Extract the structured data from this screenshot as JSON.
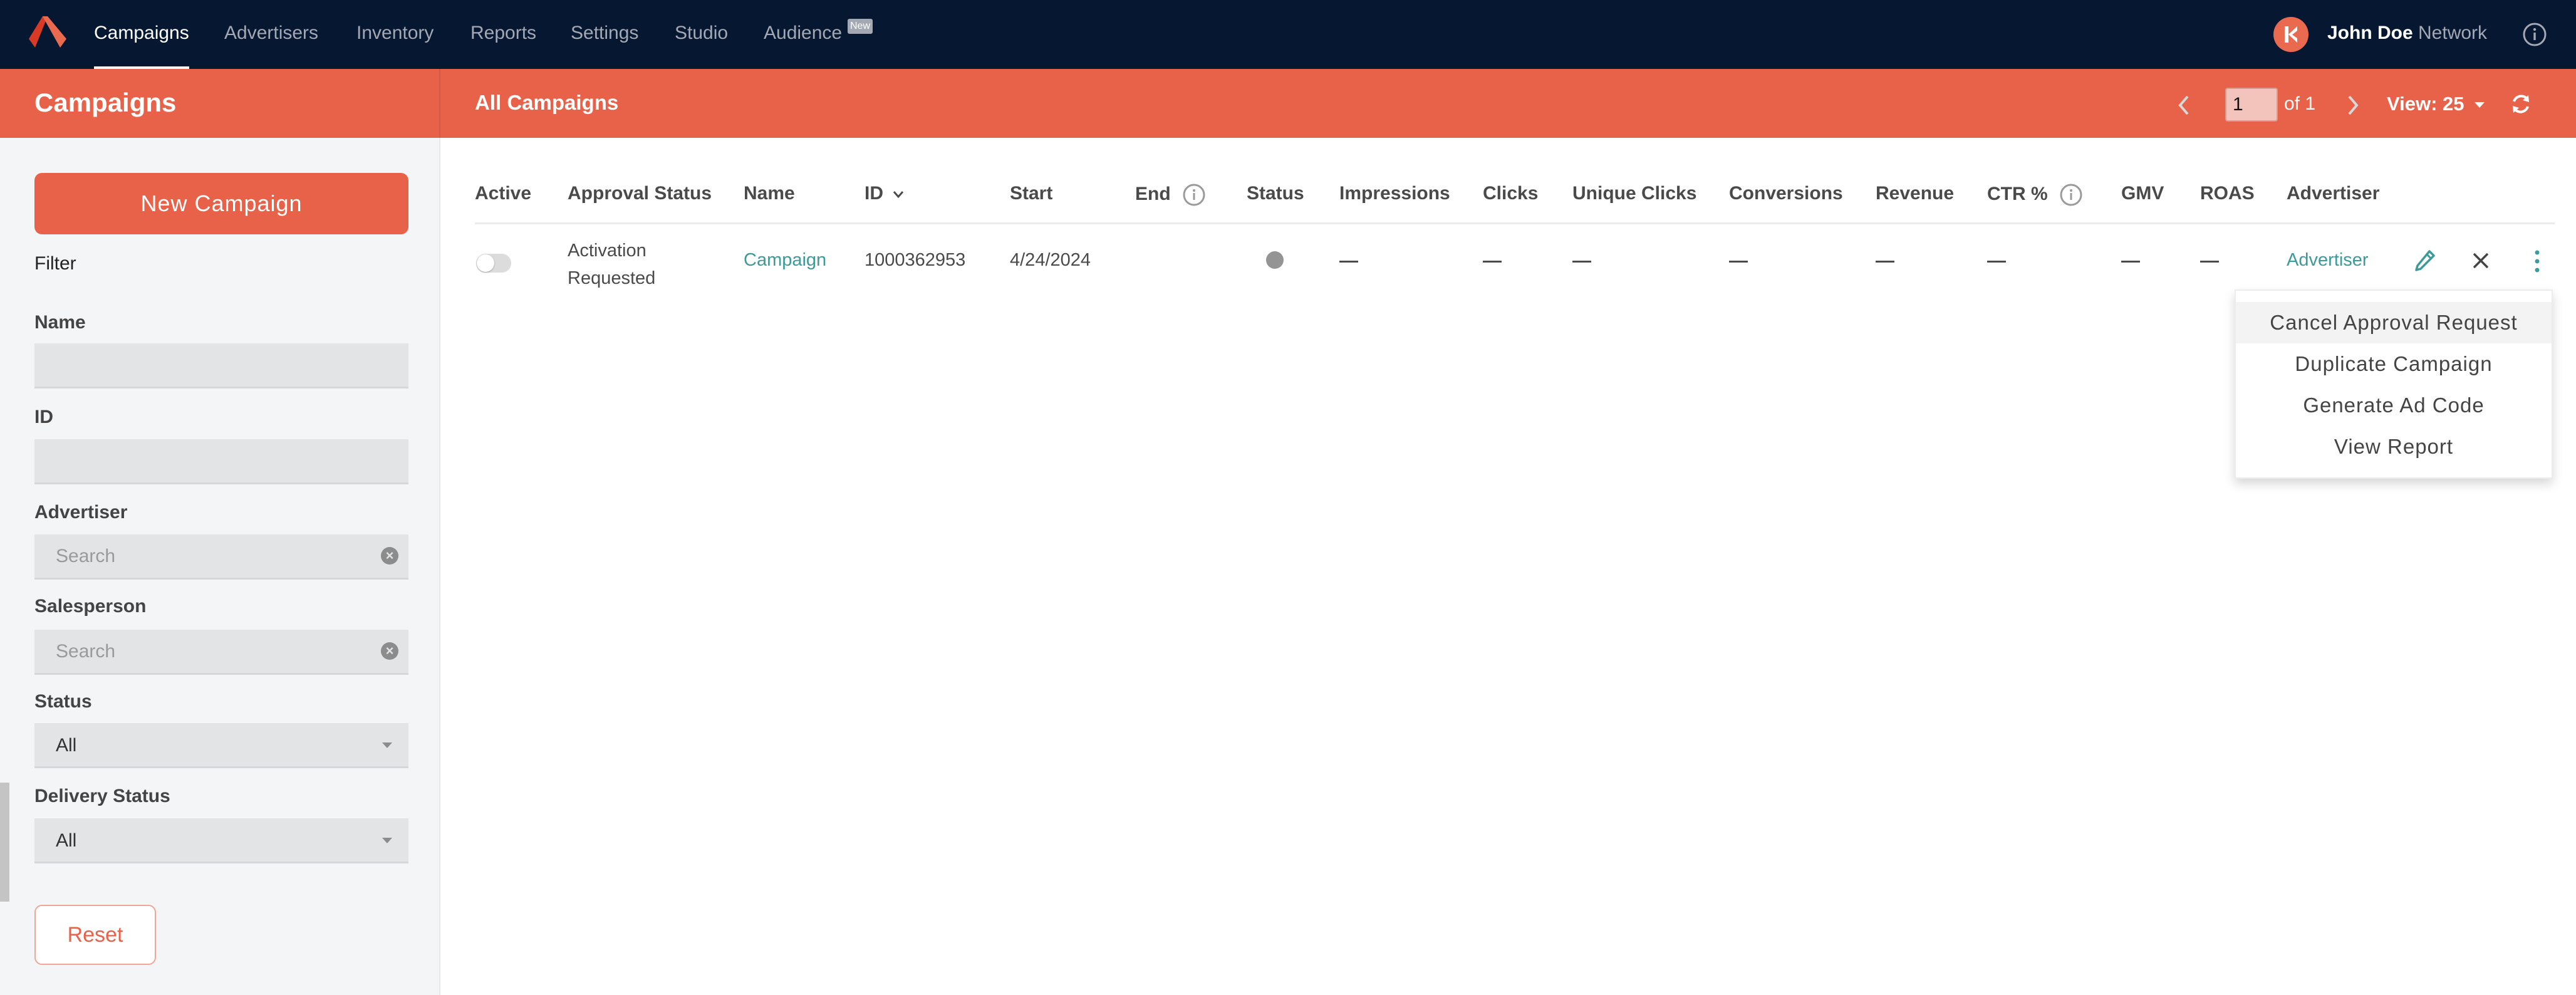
{
  "topnav": {
    "items": [
      {
        "label": "Campaigns",
        "active": true
      },
      {
        "label": "Advertisers",
        "active": false
      },
      {
        "label": "Inventory",
        "active": false
      },
      {
        "label": "Reports",
        "active": false
      },
      {
        "label": "Settings",
        "active": false
      },
      {
        "label": "Studio",
        "active": false
      },
      {
        "label": "Audience",
        "active": false,
        "badge": "New"
      }
    ],
    "user": {
      "name": "John Doe",
      "network": "Network",
      "avatar_letter_icon": "k-logo-icon"
    },
    "info_icon": "info-circle-icon",
    "logo_icon": "chevron-a-logo-icon"
  },
  "subbar": {
    "section_title": "Campaigns",
    "page_title": "All Campaigns",
    "pagination": {
      "current_page": "1",
      "of_label": "of 1",
      "prev_icon": "chevron-left-icon",
      "next_icon": "chevron-right-icon"
    },
    "view": {
      "label": "View: 25"
    },
    "refresh_icon": "refresh-icon"
  },
  "sidebar": {
    "new_button": "New Campaign",
    "filter_title": "Filter",
    "fields": {
      "name": {
        "label": "Name",
        "value": ""
      },
      "id": {
        "label": "ID",
        "value": ""
      },
      "advertiser": {
        "label": "Advertiser",
        "placeholder": "Search"
      },
      "salesperson": {
        "label": "Salesperson",
        "placeholder": "Search"
      },
      "status": {
        "label": "Status",
        "value": "All"
      },
      "delivery_status": {
        "label": "Delivery Status",
        "value": "All"
      }
    },
    "reset_button": "Reset"
  },
  "table": {
    "columns": [
      "Active",
      "Approval Status",
      "Name",
      "ID",
      "Start",
      "End",
      "Status",
      "Impressions",
      "Clicks",
      "Unique Clicks",
      "Conversions",
      "Revenue",
      "CTR %",
      "GMV",
      "ROAS",
      "Advertiser"
    ],
    "sorted_column": "ID",
    "sort_direction": "desc",
    "rows": [
      {
        "active": false,
        "approval_status_line1": "Activation",
        "approval_status_line2": "Requested",
        "name": "Campaign",
        "id": "1000362953",
        "start": "4/24/2024",
        "end": "",
        "status": "inactive",
        "impressions": "—",
        "clicks": "—",
        "unique_clicks": "—",
        "conversions": "—",
        "revenue": "—",
        "ctr": "—",
        "gmv": "—",
        "roas": "—",
        "advertiser": "Advertiser"
      }
    ]
  },
  "row_menu": {
    "items": [
      "Cancel Approval Request",
      "Duplicate Campaign",
      "Generate Ad Code",
      "View Report"
    ],
    "highlighted_index": 0
  },
  "colors": {
    "nav_bg": "#061731",
    "accent": "#e8624a",
    "link": "#3d9a9b",
    "sidebar_bg": "#f4f5f7"
  }
}
